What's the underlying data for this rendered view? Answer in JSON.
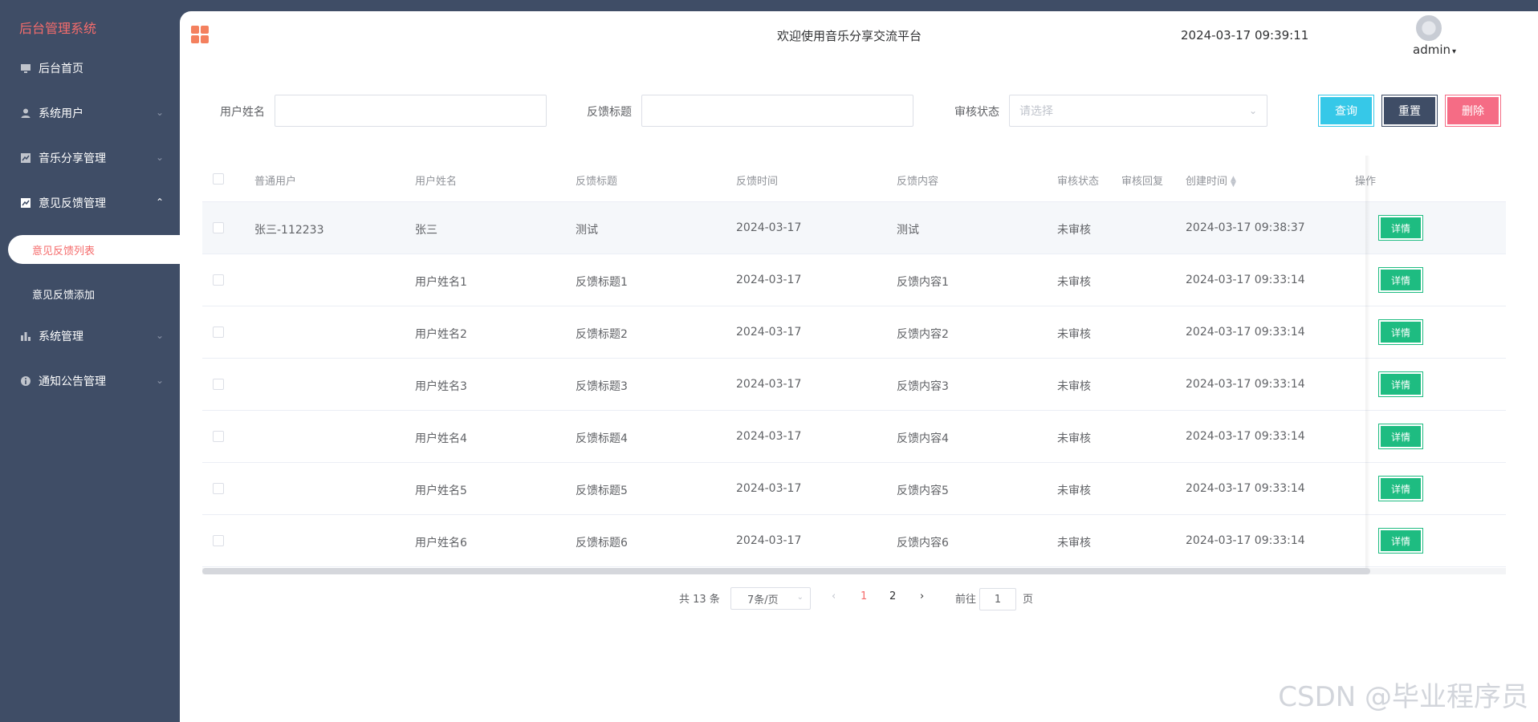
{
  "sidebar": {
    "brand": "后台管理系统",
    "items": [
      {
        "label": "后台首页",
        "icon": "monitor-icon"
      },
      {
        "label": "系统用户",
        "icon": "user-icon"
      },
      {
        "label": "音乐分享管理",
        "icon": "chart-icon"
      },
      {
        "label": "意见反馈管理",
        "icon": "trend-icon"
      },
      {
        "label": "意见反馈列表",
        "sub": true,
        "active": true
      },
      {
        "label": "意见反馈添加",
        "sub": true
      },
      {
        "label": "系统管理",
        "icon": "bar-chart-icon"
      },
      {
        "label": "通知公告管理",
        "icon": "info-icon"
      }
    ]
  },
  "header": {
    "welcome": "欢迎使用音乐分享交流平台",
    "datetime": "2024-03-17 09:39:11",
    "user": "admin"
  },
  "search": {
    "name_label": "用户姓名",
    "title_label": "反馈标题",
    "status_label": "审核状态",
    "status_placeholder": "请选择",
    "query": "查询",
    "reset": "重置",
    "delete": "删除"
  },
  "table": {
    "headers": [
      "普通用户",
      "用户姓名",
      "反馈标题",
      "反馈时间",
      "反馈内容",
      "审核状态",
      "审核回复",
      "创建时间",
      "操作"
    ],
    "detail_label": "详情",
    "rows": [
      [
        "张三-112233",
        "张三",
        "测试",
        "2024-03-17",
        "测试",
        "未审核",
        "",
        "2024-03-17 09:38:37"
      ],
      [
        "",
        "用户姓名1",
        "反馈标题1",
        "2024-03-17",
        "反馈内容1",
        "未审核",
        "",
        "2024-03-17 09:33:14"
      ],
      [
        "",
        "用户姓名2",
        "反馈标题2",
        "2024-03-17",
        "反馈内容2",
        "未审核",
        "",
        "2024-03-17 09:33:14"
      ],
      [
        "",
        "用户姓名3",
        "反馈标题3",
        "2024-03-17",
        "反馈内容3",
        "未审核",
        "",
        "2024-03-17 09:33:14"
      ],
      [
        "",
        "用户姓名4",
        "反馈标题4",
        "2024-03-17",
        "反馈内容4",
        "未审核",
        "",
        "2024-03-17 09:33:14"
      ],
      [
        "",
        "用户姓名5",
        "反馈标题5",
        "2024-03-17",
        "反馈内容5",
        "未审核",
        "",
        "2024-03-17 09:33:14"
      ],
      [
        "",
        "用户姓名6",
        "反馈标题6",
        "2024-03-17",
        "反馈内容6",
        "未审核",
        "",
        "2024-03-17 09:33:14"
      ]
    ]
  },
  "pagination": {
    "total": "共 13 条",
    "page_size": "7条/页",
    "pages": [
      "1",
      "2"
    ],
    "current": "1",
    "goto_prefix": "前往",
    "goto_value": "1",
    "goto_suffix": "页"
  },
  "watermark": "CSDN @毕业程序员"
}
